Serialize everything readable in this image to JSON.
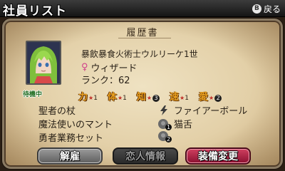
{
  "header": {
    "title": "社員リスト",
    "back_key": "B",
    "back_label": "戻る"
  },
  "document": {
    "title": "履歴書",
    "status": "待機中",
    "name": "暴飲暴食火術士ウルリーケ1世",
    "job": "ウィザード",
    "rank_label": "ランク：62",
    "stats": [
      {
        "key": "力",
        "value": "1"
      },
      {
        "key": "体",
        "value": "1"
      },
      {
        "key": "知",
        "value": "3"
      },
      {
        "key": "速",
        "value": "1"
      },
      {
        "key": "愛",
        "value": "2"
      }
    ],
    "equipment": [
      "聖者の杖",
      "魔法使いのマント",
      "勇者業務セット"
    ],
    "skills": [
      {
        "icon": "lightning-icon",
        "label": "ファイアーボール",
        "badge": ""
      },
      {
        "icon": "skill-badge-icon",
        "label": "猫舌",
        "badge": "1"
      },
      {
        "icon": "skill-badge-icon",
        "label": "",
        "badge": "2"
      }
    ]
  },
  "buttons": {
    "dismiss": "解雇",
    "friend_info": "恋人情報",
    "change_equipment": "装備変更"
  },
  "colors": {
    "stat_key": "#e8a020",
    "status_tag": "#1e6b1e",
    "equip_button": "#c03050",
    "hair": "#8fcf4a"
  }
}
